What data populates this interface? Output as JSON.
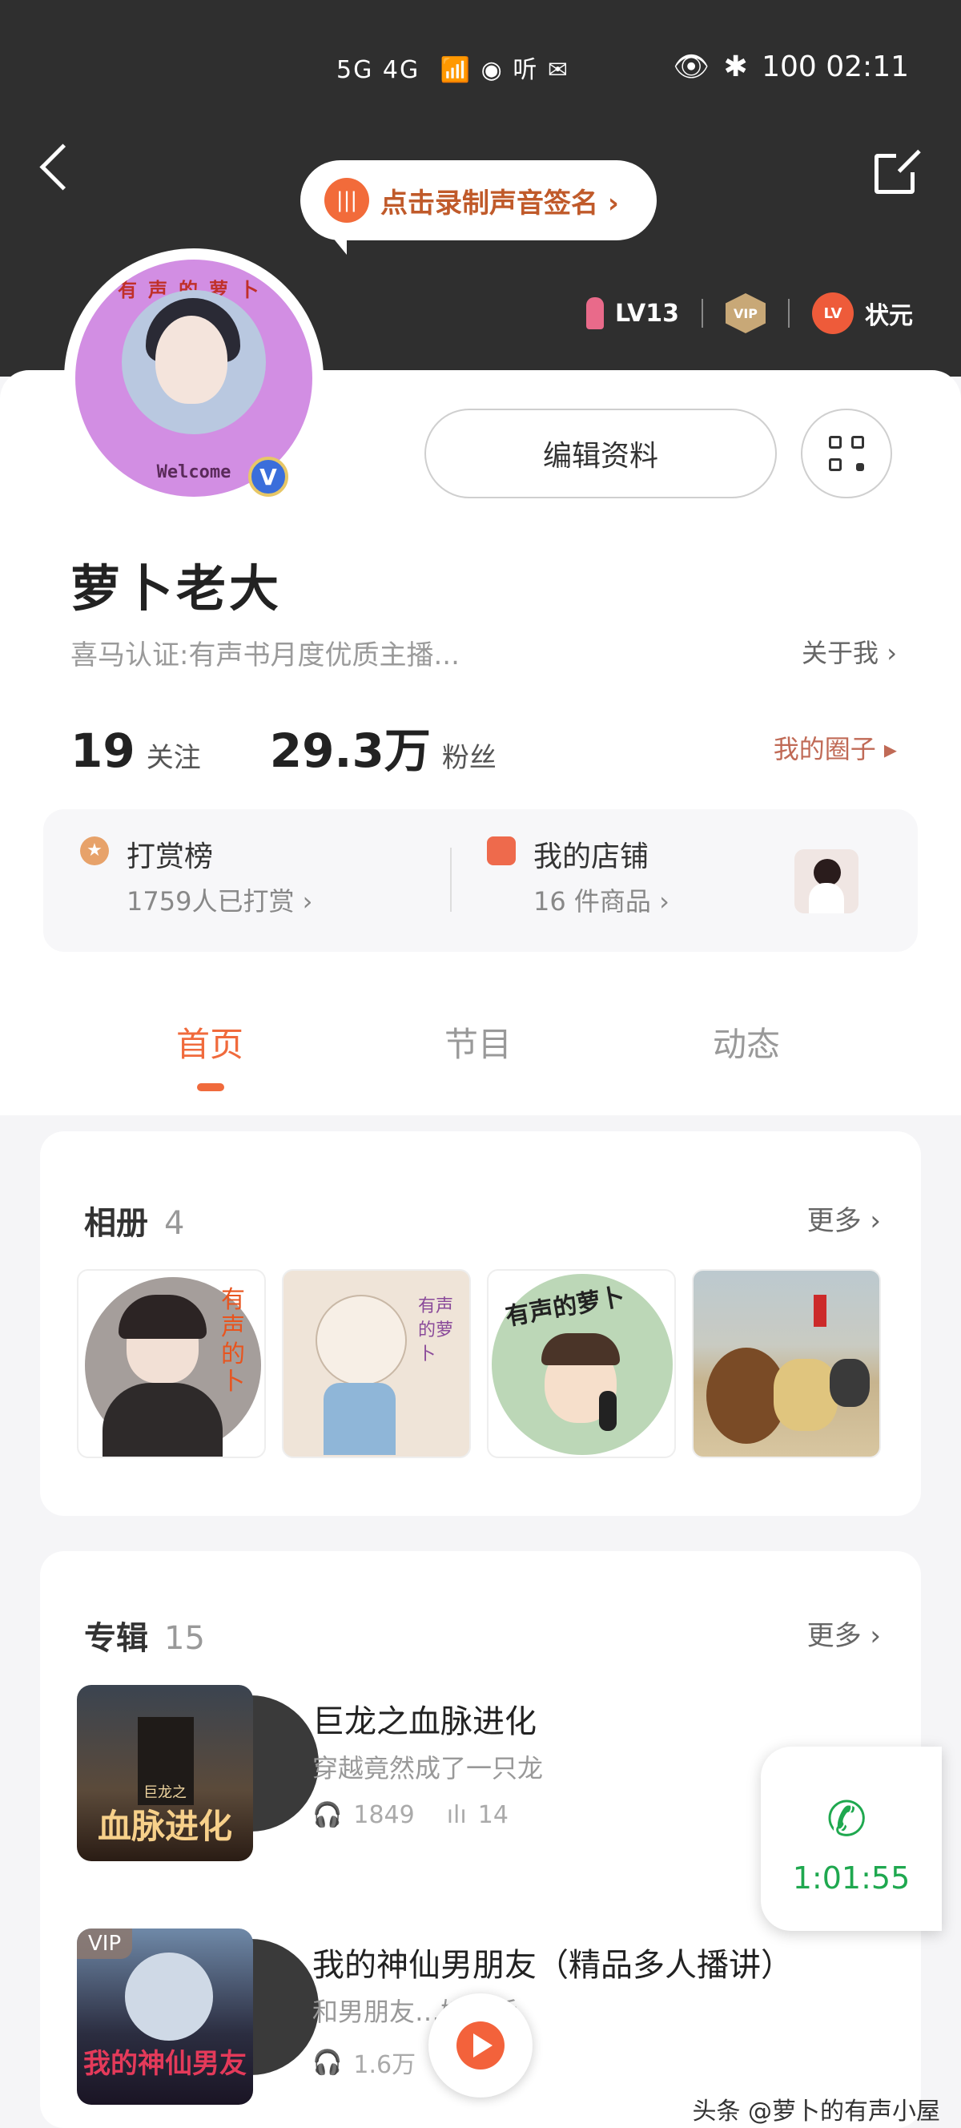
{
  "status_bar": {
    "signal": "5G 4G",
    "right": "100 02:11"
  },
  "header": {
    "record_bubble": "点击录制声音签名 ›",
    "level": "LV13",
    "vip": "VIP",
    "lv_badge": "LV",
    "rank": "状元"
  },
  "profile": {
    "avatar_text": "Welcome",
    "avatar_ring_text": "有声的萝卜",
    "verified_mark": "V",
    "edit_label": "编辑资料",
    "name": "萝卜老大",
    "certification": "喜马认证:有声书月度优质主播...",
    "about": "关于我 ›",
    "following_count": "19",
    "following_label": "关注",
    "fans_count": "29.3万",
    "fans_label": "粉丝",
    "circle_link": "我的圈子 ▸"
  },
  "rewards": {
    "reward_title": "打赏榜",
    "reward_sub": "1759人已打赏 ›",
    "shop_title": "我的店铺",
    "shop_sub": "16 件商品 ›"
  },
  "tabs": [
    "首页",
    "节目",
    "动态"
  ],
  "album_section": {
    "title": "相册",
    "count": "4",
    "more": "更多 ›",
    "photo1_text": "有声的卜",
    "photo2_text": "有声的萝卜",
    "photo3_text": "有声的萝卜"
  },
  "albums_section": {
    "title": "专辑",
    "count": "15",
    "more": "更多 ›",
    "items": [
      {
        "title": "巨龙之血脉进化",
        "subtitle": "穿越竟然成了一只龙",
        "plays": "1849",
        "episodes": "14",
        "cover_text": "血脉进化",
        "cover_small": "巨龙之"
      },
      {
        "title": "我的神仙男朋友（精品多人播讲）",
        "subtitle": "和男朋友…妖生活",
        "plays": "1.6万",
        "vip": "VIP",
        "cover_text": "我的神仙男友"
      }
    ]
  },
  "call_float": {
    "time": "1:01:55"
  },
  "watermark": "头条 @萝卜的有声小屋",
  "colors": {
    "accent": "#f06a3c",
    "header_bg": "#2f2f2f",
    "call_green": "#1fa84f"
  }
}
